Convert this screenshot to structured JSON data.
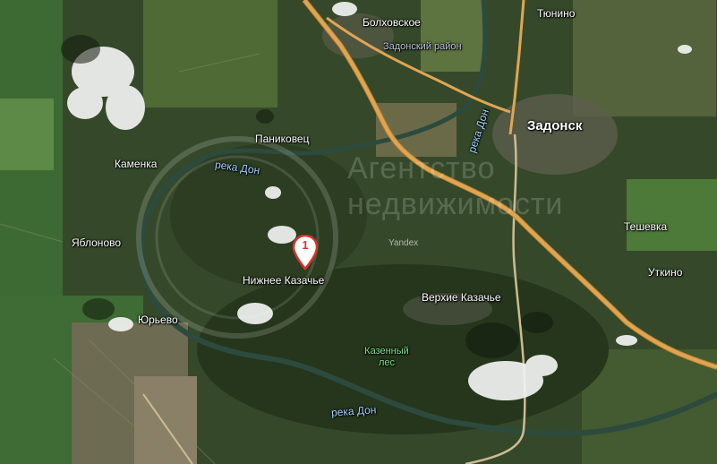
{
  "map": {
    "settlements": [
      {
        "key": "bolkhovskoe",
        "name": "Болховское"
      },
      {
        "key": "tyunino",
        "name": "Тюнино"
      },
      {
        "key": "zadonsk",
        "name": "Задонск"
      },
      {
        "key": "panikovets",
        "name": "Паниковец"
      },
      {
        "key": "kamenka",
        "name": "Каменка"
      },
      {
        "key": "yablonovo",
        "name": "Яблоново"
      },
      {
        "key": "teshevka",
        "name": "Тешевка"
      },
      {
        "key": "utkino",
        "name": "Уткино"
      },
      {
        "key": "nizhnee_kazachye",
        "name": "Нижнее Казачье"
      },
      {
        "key": "verkhie_kazachye",
        "name": "Верхие Казачье"
      },
      {
        "key": "yurevo",
        "name": "Юрьево"
      }
    ],
    "district": "Задонский район",
    "rivers": {
      "don_north": "река Дон",
      "don_vertical": "река Дон",
      "don_south": "река Дон"
    },
    "forest": {
      "line1": "Казенный",
      "line2": "лес"
    },
    "marker": {
      "number": "1",
      "color": "#d9322b"
    },
    "provider": "Yandex",
    "watermark": {
      "line1": "Агентство",
      "line2": "недвижимости"
    },
    "colors": {
      "road": "#e0a553",
      "road_edge": "#b7812f",
      "river": "#7aa7d8"
    }
  }
}
